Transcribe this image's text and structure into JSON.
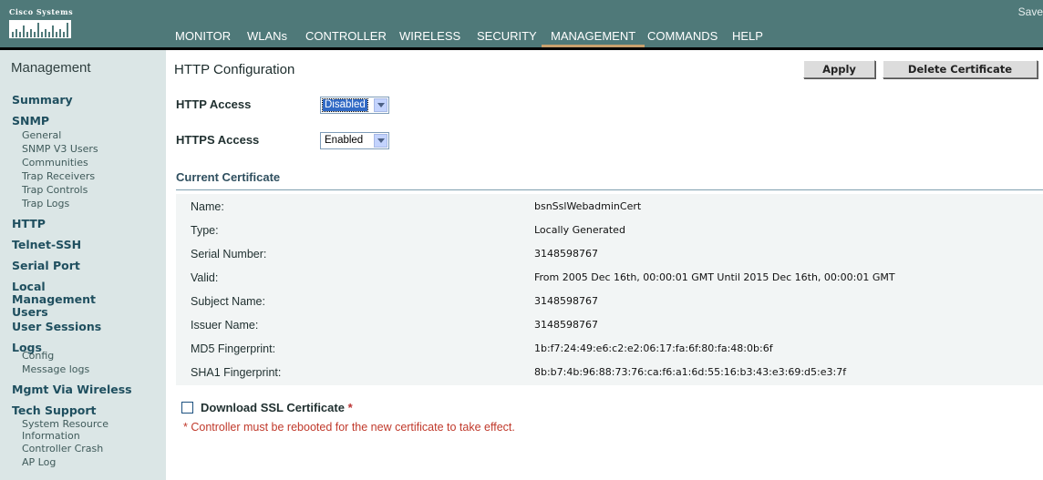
{
  "brand": {
    "logo_text": "Cisco Systems",
    "save_label": "Save"
  },
  "menu": [
    {
      "label": "MONITOR",
      "active": false
    },
    {
      "label": "WLANs",
      "active": false
    },
    {
      "label": "CONTROLLER",
      "active": false
    },
    {
      "label": "WIRELESS",
      "active": false
    },
    {
      "label": "SECURITY",
      "active": false
    },
    {
      "label": "MANAGEMENT",
      "active": true
    },
    {
      "label": "COMMANDS",
      "active": false
    },
    {
      "label": "HELP",
      "active": false
    }
  ],
  "sidebar": {
    "title": "Management",
    "sections": [
      {
        "label": "Summary",
        "items": []
      },
      {
        "label": "SNMP",
        "items": [
          "General",
          "SNMP V3 Users",
          "Communities",
          "Trap Receivers",
          "Trap Controls",
          "Trap Logs"
        ]
      },
      {
        "label": "HTTP",
        "items": []
      },
      {
        "label": "Telnet-SSH",
        "items": []
      },
      {
        "label": "Serial Port",
        "items": []
      },
      {
        "label": "Local Management Users",
        "items": []
      },
      {
        "label": "User Sessions",
        "items": []
      },
      {
        "label": "Logs",
        "items": [
          "Config",
          "Message logs"
        ]
      },
      {
        "label": "Mgmt Via Wireless",
        "items": []
      },
      {
        "label": "Tech Support",
        "items": [
          "System Resource Information",
          "Controller Crash",
          "AP Log"
        ]
      }
    ]
  },
  "main": {
    "title": "HTTP Configuration",
    "apply_label": "Apply",
    "delete_cert_label": "Delete Certificate",
    "http_access": {
      "label": "HTTP Access",
      "value": "Disabled"
    },
    "https_access": {
      "label": "HTTPS Access",
      "value": "Enabled"
    },
    "certificate": {
      "title": "Current Certificate",
      "rows": [
        {
          "label": "Name:",
          "value": "bsnSslWebadminCert"
        },
        {
          "label": "Type:",
          "value": "Locally Generated"
        },
        {
          "label": "Serial Number:",
          "value": "3148598767"
        },
        {
          "label": "Valid:",
          "value": "From 2005 Dec 16th, 00:00:01 GMT  Until 2015 Dec 16th, 00:00:01 GMT"
        },
        {
          "label": "Subject Name:",
          "value": "3148598767"
        },
        {
          "label": "Issuer Name:",
          "value": "3148598767"
        },
        {
          "label": "MD5 Fingerprint:",
          "value": "1b:f7:24:49:e6:c2:e2:06:17:fa:6f:80:fa:48:0b:6f"
        },
        {
          "label": "SHA1 Fingerprint:",
          "value": "8b:b7:4b:96:88:73:76:ca:f6:a1:6d:55:16:b3:43:e3:69:d5:e3:7f"
        }
      ]
    },
    "download_ssl": {
      "label": "Download SSL Certificate",
      "star": "*",
      "checked": false
    },
    "note": "* Controller must be rebooted for the new certificate to take effect."
  },
  "colors": {
    "header_bg": "#4f7979",
    "sidebar_bg": "#dbe6e6",
    "active_underline": "#c8a06e",
    "note_red": "#c0392b"
  }
}
